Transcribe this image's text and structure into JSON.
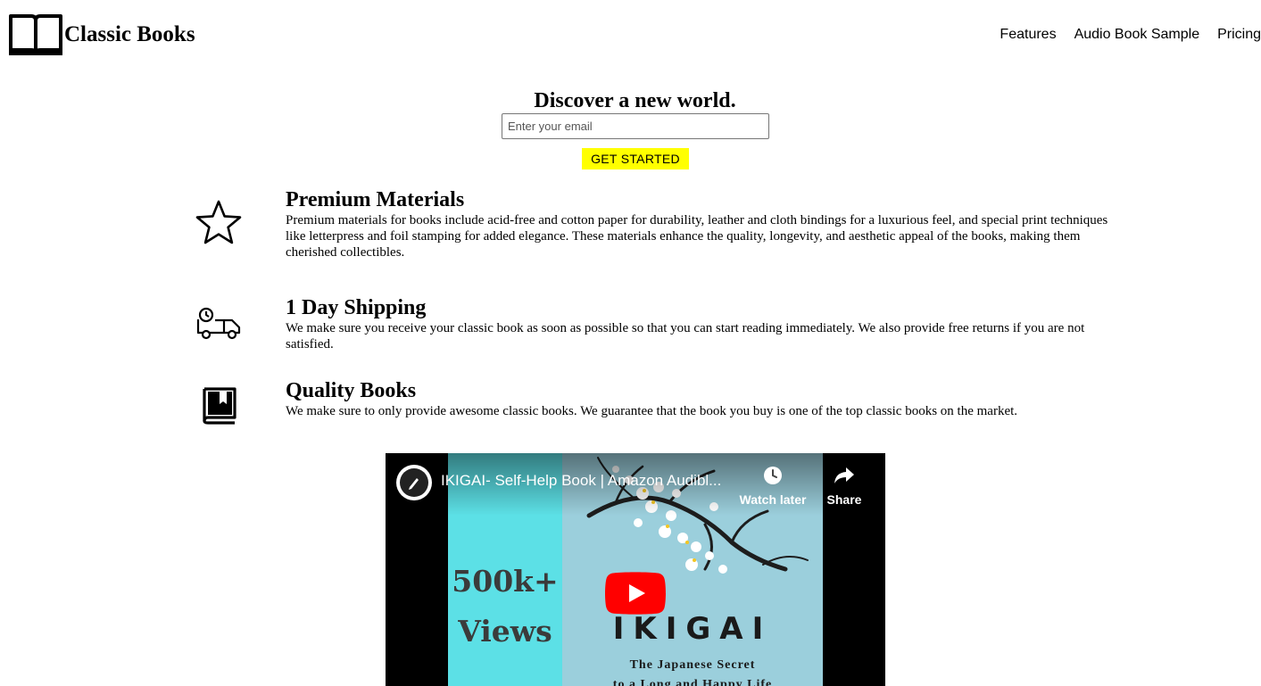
{
  "brand": {
    "name": "Classic Books",
    "logo_icon": "open-book-icon"
  },
  "nav": {
    "items": [
      "Features",
      "Audio Book Sample",
      "Pricing"
    ]
  },
  "hero": {
    "title": "Discover a new world.",
    "email_placeholder": "Enter your email",
    "email_value": "",
    "cta_label": "GET STARTED",
    "cta_color": "#ffff00"
  },
  "features": [
    {
      "icon": "star-icon",
      "title": "Premium Materials",
      "desc": "Premium materials for books include acid-free and cotton paper for durability, leather and cloth bindings for a luxurious feel, and special print techniques like letterpress and foil stamping for added elegance. These materials enhance the quality, longevity, and aesthetic appeal of the books, making them cherished collectibles."
    },
    {
      "icon": "shipping-truck-icon",
      "title": "1 Day Shipping",
      "desc": "We make sure you receive your classic book as soon as possible so that you can start reading immediately. We also provide free returns if you are not satisfied."
    },
    {
      "icon": "book-icon",
      "title": "Quality Books",
      "desc": "We make sure to only provide awesome classic books. We guarantee that the book you buy is one of the top classic books on the market."
    }
  ],
  "video": {
    "title": "IKIGAI- Self-Help Book | Amazon Audibl...",
    "watch_later_label": "Watch later",
    "share_label": "Share",
    "thumbnail": {
      "views_line1": "500k+",
      "views_line2": "Views",
      "cover_title": "IKIGAI",
      "cover_subtitle_line1": "The Japanese Secret",
      "cover_subtitle_line2": "to a Long and Happy Life"
    }
  }
}
